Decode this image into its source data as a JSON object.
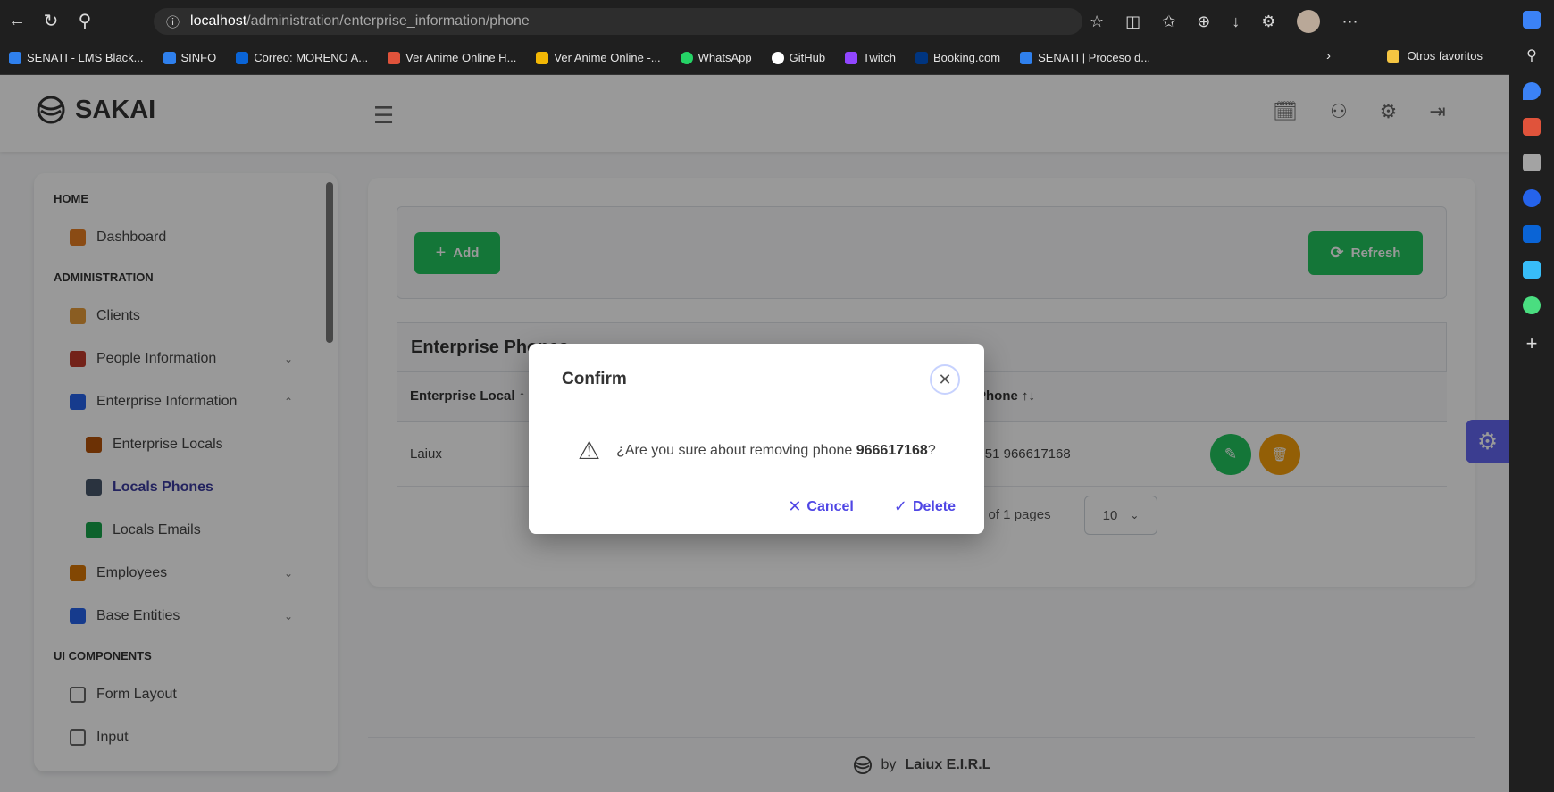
{
  "browser": {
    "url_host": "localhost",
    "url_path": "/administration/enterprise_information/phone",
    "bookmarks": [
      {
        "label": "SENATI - LMS Black...",
        "color": "#2f80ed"
      },
      {
        "label": "SINFO",
        "color": "#2f80ed"
      },
      {
        "label": "Correo: MORENO A...",
        "color": "#0a64d6"
      },
      {
        "label": "Ver Anime Online H...",
        "color": "#e0533b"
      },
      {
        "label": "Ver Anime Online -...",
        "color": "#f2b705"
      },
      {
        "label": "WhatsApp",
        "color": "#25d366"
      },
      {
        "label": "GitHub",
        "color": "#ffffff"
      },
      {
        "label": "Twitch",
        "color": "#9146ff"
      },
      {
        "label": "Booking.com",
        "color": "#003580"
      },
      {
        "label": "SENATI | Proceso d...",
        "color": "#2f80ed"
      }
    ],
    "other_favorites": "Otros favoritos"
  },
  "app": {
    "brand": "SAKAI",
    "footer_by": "by",
    "footer_company": "Laiux E.I.R.L"
  },
  "sidebar": {
    "sections": [
      {
        "title": "HOME",
        "items": [
          {
            "label": "Dashboard",
            "icon": "home-icon",
            "color": "#e67e22"
          }
        ]
      },
      {
        "title": "ADMINISTRATION",
        "items": [
          {
            "label": "Clients",
            "icon": "clients-icon",
            "color": "#e69b3a"
          },
          {
            "label": "People Information",
            "icon": "people-info-icon",
            "color": "#c0392b",
            "chevron": "⌄"
          },
          {
            "label": "Enterprise Information",
            "icon": "enterprise-info-icon",
            "color": "#2563eb",
            "chevron": "⌃"
          },
          {
            "label": "Enterprise Locals",
            "icon": "enterprise-locals-icon",
            "color": "#b45309",
            "sub": true
          },
          {
            "label": "Locals Phones",
            "icon": "locals-phones-icon",
            "color": "#475569",
            "sub": true,
            "active": true
          },
          {
            "label": "Locals Emails",
            "icon": "locals-emails-icon",
            "color": "#16a34a",
            "sub": true
          },
          {
            "label": "Employees",
            "icon": "employees-icon",
            "color": "#d97706",
            "chevron": "⌄"
          },
          {
            "label": "Base Entities",
            "icon": "base-entities-icon",
            "color": "#2563eb",
            "chevron": "⌄"
          }
        ]
      },
      {
        "title": "UI COMPONENTS",
        "items": [
          {
            "label": "Form Layout",
            "icon": "form-layout-icon",
            "color": "#666666"
          },
          {
            "label": "Input",
            "icon": "input-icon",
            "color": "#666666"
          }
        ]
      }
    ]
  },
  "toolbar": {
    "add_label": "Add",
    "refresh_label": "Refresh"
  },
  "table": {
    "title": "Enterprise Phones",
    "col_local": "Enterprise Local ↑",
    "col_phone": "Phone ↑↓",
    "rows": [
      {
        "local": "Laiux",
        "phone": "+51 966617168"
      }
    ],
    "pages_text": "1 of 1 pages",
    "rows_per_page": "10"
  },
  "dialog": {
    "title": "Confirm",
    "message_prefix": "¿Are you sure about removing phone ",
    "phone": "966617168",
    "message_suffix": "?",
    "cancel_label": "Cancel",
    "delete_label": "Delete"
  },
  "colors": {
    "primary": "#6366f1",
    "success": "#22c55e",
    "warning": "#f59e0b"
  }
}
